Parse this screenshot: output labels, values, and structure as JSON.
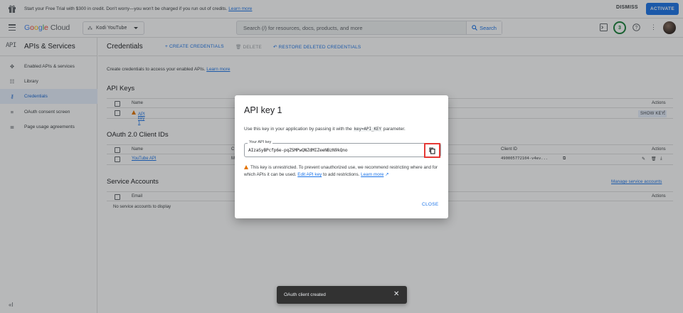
{
  "banner": {
    "message": "Start your Free Trial with $300 in credit. Don't worry—you won't be charged if you run out of credits.",
    "learn_more": "Learn more",
    "dismiss": "DISMISS",
    "activate": "ACTIVATE"
  },
  "topbar": {
    "logo_google": [
      "G",
      "o",
      "o",
      "g",
      "l",
      "e"
    ],
    "logo_cloud": "Cloud",
    "project": "Kodi YouTube",
    "search_placeholder": "Search (/) for resources, docs, products, and more",
    "search_button": "Search",
    "notifications_count": "3"
  },
  "sidebar": {
    "title": "APIs & Services",
    "api_icon": "API",
    "items": [
      {
        "label": "Enabled APIs & services",
        "icon": "hub-icon"
      },
      {
        "label": "Library",
        "icon": "library-icon"
      },
      {
        "label": "Credentials",
        "icon": "key-icon"
      },
      {
        "label": "OAuth consent screen",
        "icon": "consent-icon"
      },
      {
        "label": "Page usage agreements",
        "icon": "settings-list-icon"
      }
    ],
    "collapse_icon": "«I"
  },
  "actionbar": {
    "title": "Credentials",
    "create": "+ CREATE CREDENTIALS",
    "delete": "DELETE",
    "restore": "RESTORE DELETED CREDENTIALS"
  },
  "main": {
    "intro": "Create credentials to access your enabled APIs.",
    "intro_link": "Learn more",
    "api_keys": {
      "heading": "API Keys",
      "col_name": "Name",
      "col_actions": "Actions",
      "rows": [
        {
          "name": "API key 1",
          "show_key": "SHOW KEY"
        }
      ]
    },
    "oauth": {
      "heading": "OAuth 2.0 Client IDs",
      "col_name": "Name",
      "col_c": "C",
      "col_client_id": "Client ID",
      "col_actions": "Actions",
      "rows": [
        {
          "name": "YouTube API",
          "m": "M",
          "client_id": "490005772104-v4ev..."
        }
      ]
    },
    "service_accounts": {
      "heading": "Service Accounts",
      "manage": "Manage service accounts",
      "col_email": "Email",
      "col_actions": "Actions",
      "empty": "No service accounts to display"
    }
  },
  "dialog": {
    "title": "API key 1",
    "desc_pre": "Use this key in your application by passing it with the",
    "desc_code": "key=API_KEY",
    "desc_post": "parameter.",
    "field_label": "Your API key",
    "api_key": "AIzaSyBPcfp6e-pqZSMPwQNZdMIZeeNBzN9kQno",
    "warning": "This key is unrestricted. To prevent unauthorized use, we recommend restricting where and for which APIs it can be used.",
    "edit_link": "Edit API key",
    "warning_post": "to add restrictions.",
    "learn_more": "Learn more",
    "close": "CLOSE"
  },
  "snackbar": {
    "text": "OAuth client created",
    "close": "✕"
  },
  "colors": {
    "accent": "#1a73e8",
    "activate_bg": "#1a73e8",
    "highlight_border": "#e53935",
    "warning": "#e37400",
    "notification": "#188038"
  }
}
